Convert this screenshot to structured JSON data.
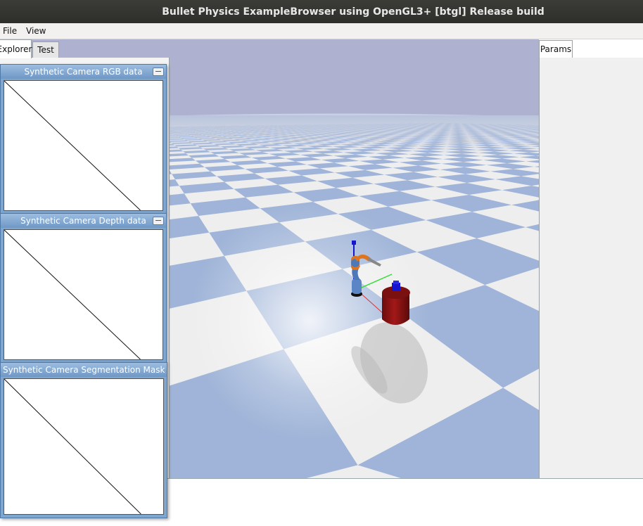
{
  "window": {
    "title": "Bullet Physics ExampleBrowser using OpenGL3+ [btgl] Release build"
  },
  "menu": {
    "file": "File",
    "view": "View"
  },
  "left_tabs": {
    "explorer": "Explorer",
    "test": "Test"
  },
  "right_tabs": {
    "params": "Params"
  },
  "camera_windows": [
    {
      "title": "Synthetic Camera RGB data"
    },
    {
      "title": "Synthetic Camera Depth data"
    },
    {
      "title": "Synthetic Camera Segmentation Mask"
    }
  ],
  "scene": {
    "sky_color": "#aeb1cf",
    "floor_light": "#f0f0f0",
    "floor_blue": "#9fb4d8",
    "cylinder_color": "#8c1111",
    "robot_color": "#5b86c6",
    "robot_accent": "#e0731d"
  }
}
